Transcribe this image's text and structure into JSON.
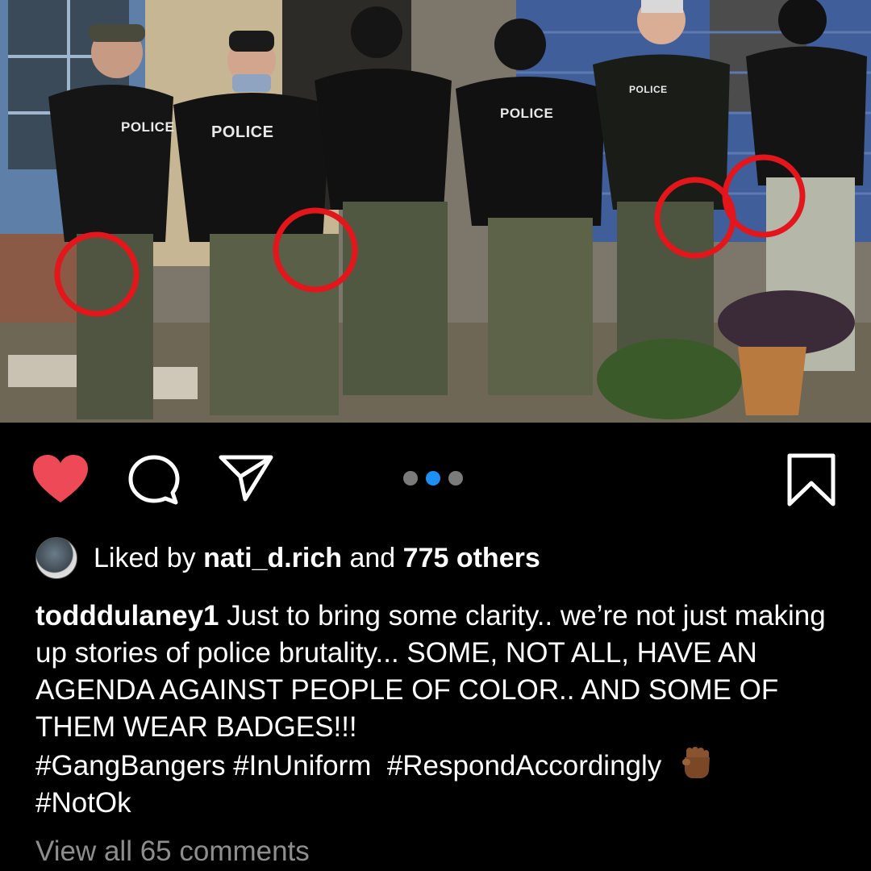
{
  "post": {
    "image_description": "Group photo of six officers in tactical gear with red circles drawn around their hands",
    "labels": {
      "officer1": "POLICE",
      "officer2": "POLICE",
      "officer4": "POLICE",
      "officer5": "POLICE"
    },
    "carousel": {
      "count": 3,
      "active_index": 1
    }
  },
  "actions": {
    "like_icon": "heart-filled-icon",
    "comment_icon": "comment-icon",
    "share_icon": "send-icon",
    "save_icon": "bookmark-icon",
    "like_color": "#ed4956"
  },
  "likes": {
    "prefix": "Liked by",
    "user": "nati_d.rich",
    "middle": "and",
    "others": "775 others"
  },
  "caption": {
    "username": "todddulaney1",
    "text": "Just to bring some clarity.. we’re not just making up stories of police brutality... SOME, NOT ALL, HAVE AN AGENDA AGAINST PEOPLE OF COLOR.. AND SOME OF THEM WEAR BADGES!!!",
    "hashtags": [
      "#GangBangers",
      "#InUniform",
      "#RespondAccordingly",
      "#NotOk"
    ],
    "emoji": "raised-fist-icon"
  },
  "comments": {
    "view_all": "View all 65 comments"
  },
  "colors": {
    "background": "#000000",
    "accent_blue": "#1e90f3",
    "muted_text": "#8e8e8e",
    "highlight_circle": "#e3161b"
  }
}
